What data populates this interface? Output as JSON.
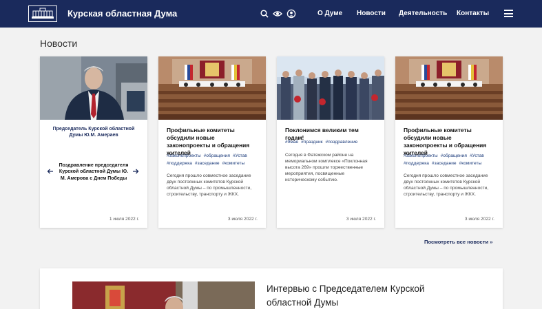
{
  "header": {
    "site_title": "Курская областная Дума",
    "icons": [
      "search-icon",
      "eye-icon",
      "user-icon",
      "menu-icon"
    ],
    "nav": [
      "О Думе",
      "Новости",
      "Деятельность",
      "Контакты"
    ]
  },
  "news": {
    "section_title": "Новости",
    "slider": {
      "caption": "Председатель Курской областной Думы Ю.М. Амераев",
      "title": "Поздравление председателя Курской областной Думы Ю. М. Амерова с Днем Победы",
      "date": "1 июля 2022 г."
    },
    "cards": [
      {
        "title": "Профильные комитеты обсудили новые законопроекты и обращения жителей",
        "tags": [
          "#законопроекты",
          "#обращения",
          "#Устав",
          "#поддержка",
          "#заседание",
          "#комитеты"
        ],
        "text": "Сегодня прошло совместное заседание двух постоянных комитетов Курской областной Думы – по промышленности, строительству, транспорту и ЖКХ.",
        "date": "3 июля 2022 г."
      },
      {
        "title": "Поклонимся великим тем годам!",
        "tags": [
          "#9мая",
          "#праздник",
          "#поздравление"
        ],
        "text": "Сегодня в Фатежском районе на мемориальном комплексе «Поклонная высота 269» прошли торжественные мероприятия, посвященные историческому событию.",
        "date": "3 июля 2022 г."
      },
      {
        "title": "Профильные комитеты обсудили новые законопроекты и обращения жителей",
        "tags": [
          "#законопроекты",
          "#обращения",
          "#Устав",
          "#поддержка",
          "#заседание",
          "#комитеты"
        ],
        "text": "Сегодня прошло совместное заседание двух постоянных комитетов Курской областной Думы – по промышленности, строительству, транспорту и ЖКХ.",
        "date": "3 июля 2022 г."
      }
    ],
    "all_news_link": "Посмотреть все новости"
  },
  "interview": {
    "title": "Интервью с Председателем Курской областной Думы"
  },
  "colors": {
    "header_bg": "#1a2a5c",
    "accent": "#1a3a7a",
    "page_bg": "#f2f2f2"
  }
}
